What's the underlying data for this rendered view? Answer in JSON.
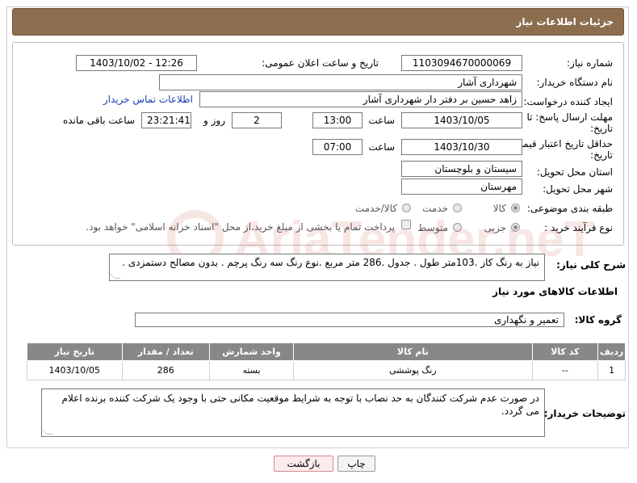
{
  "header": {
    "title": "جزئیات اطلاعات نیاز"
  },
  "form": {
    "need_number_label": "شماره نیاز:",
    "need_number": "1103094670000069",
    "announce_label": "تاریخ و ساعت اعلان عمومی:",
    "announce_value": "1403/10/02 - 12:26",
    "buyer_org_label": "نام دستگاه خریدار:",
    "buyer_org": "شهرداری آشار",
    "requester_label": "ایجاد کننده درخواست:",
    "requester": "زاهد حسین بر دفتر دار شهرداری آشار",
    "contact_link": "اطلاعات تماس خریدار",
    "deadline_label_1": "مهلت ارسال پاسخ: تا",
    "deadline_label_2": "تاریخ:",
    "deadline_date": "1403/10/05",
    "time_label": "ساعت",
    "deadline_time": "13:00",
    "days_value": "2",
    "days_label": "روز و",
    "remaining_time": "23:21:41",
    "remaining_label": "ساعت باقی مانده",
    "min_validity_label_1": "حداقل تاریخ اعتبار قیمت: تا",
    "min_validity_label_2": "تاریخ:",
    "validity_date": "1403/10/30",
    "validity_time": "07:00",
    "province_label": "استان محل تحویل:",
    "province": "سیستان و بلوچستان",
    "city_label": "شهر محل تحویل:",
    "city": "مهرستان",
    "category_label": "طبقه بندی موضوعی:",
    "category_options": [
      "کالا",
      "خدمت",
      "کالا/خدمت"
    ],
    "process_label": "نوع فرآیند خرید :",
    "process_options": [
      "جزیی",
      "متوسط"
    ],
    "payment_note": "پرداخت تمام یا بخشی از مبلغ خرید،از محل \"اسناد خزانه اسلامی\" خواهد بود."
  },
  "description": {
    "label": "شرح کلی نیاز:",
    "text": "نیاز به رنگ کاز .103متر طول . جدول .286 متر مربع .نوع رنگ سه رنگ پرچم .  بدون مصالح دستمزدی ."
  },
  "goods_section": {
    "title": "اطلاعات کالاهای مورد نیاز",
    "group_label": "گروه کالا:",
    "group_value": "تعمیر و نگهداری"
  },
  "table": {
    "headers": [
      "ردیف",
      "کد کالا",
      "نام کالا",
      "واحد شمارش",
      "تعداد / مقدار",
      "تاریخ نیاز"
    ],
    "rows": [
      [
        "1",
        "--",
        "رنگ پوششی",
        "بسته",
        "286",
        "1403/10/05"
      ]
    ]
  },
  "buyer_notes": {
    "label": "توضیحات خریدار:",
    "text": "در صورت عدم شرکت کنندگان به حد نصاب با توجه به شرایط موقعیت مکانی حتی با وجود یک شرکت کننده برنده اعلام می گردد."
  },
  "buttons": {
    "print": "چاپ",
    "back": "بازگشت"
  },
  "watermark": {
    "text": "AriaTender.neT"
  },
  "colors": {
    "title_bar": "#8c6e4e",
    "table_header": "#888888",
    "link": "#1a3fb0"
  }
}
